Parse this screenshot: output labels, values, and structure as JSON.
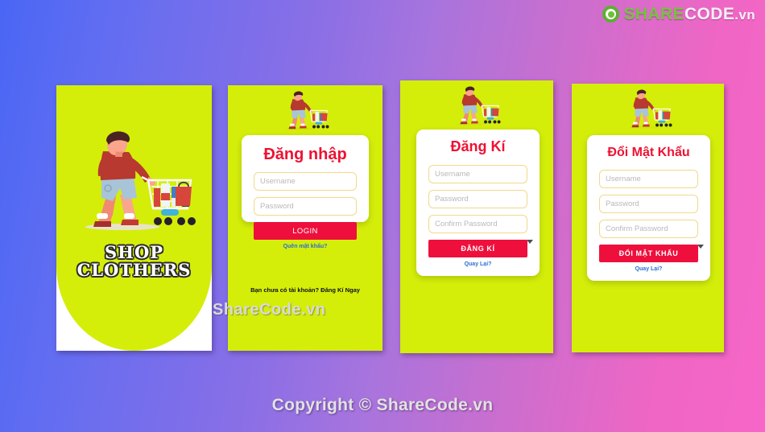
{
  "brand": {
    "logo_icon": "sharecode-recycle-icon",
    "logo_share": "SHARE",
    "logo_code": "CODE",
    "logo_vn": ".vn",
    "accent_red": "#ee0f3c",
    "accent_green": "#d4ee0a",
    "accent_blue_link": "#2b6fd4"
  },
  "watermarks": {
    "middle": "ShareCode.vn",
    "bottom": "Copyright © ShareCode.vn"
  },
  "panels": [
    {
      "name": "splash",
      "title_line1": "SHOP",
      "title_line2": "CLOTHERS",
      "illustration": "man-with-shopping-cart-illustration"
    },
    {
      "name": "login",
      "illustration": "man-with-shopping-cart-illustration",
      "card_title": "Đăng nhập",
      "fields": [
        {
          "name": "username",
          "placeholder": "Username",
          "value": ""
        },
        {
          "name": "password",
          "placeholder": "Password",
          "value": ""
        }
      ],
      "submit_label": "LOGIN",
      "sub_link": "Quên mật khẩu?",
      "footnote": "Bạn chưa có tài khoản?  Đăng Kí Ngay"
    },
    {
      "name": "register",
      "illustration": "man-with-shopping-cart-illustration",
      "card_title": "Đăng Kí",
      "fields": [
        {
          "name": "username",
          "placeholder": "Username",
          "value": ""
        },
        {
          "name": "password",
          "placeholder": "Password",
          "value": ""
        },
        {
          "name": "confirm-password",
          "placeholder": "Confirm Password",
          "value": ""
        }
      ],
      "submit_label": "ĐĂNG KÍ",
      "sub_link": "Quay Lại?"
    },
    {
      "name": "change-password",
      "illustration": "man-with-shopping-cart-illustration",
      "card_title": "Đổi Mật Khẩu",
      "fields": [
        {
          "name": "username",
          "placeholder": "Username",
          "value": ""
        },
        {
          "name": "password",
          "placeholder": "Password",
          "value": ""
        },
        {
          "name": "confirm-password",
          "placeholder": "Confirm Password",
          "value": ""
        }
      ],
      "submit_label": "ĐỔI MẬT KHẨU",
      "sub_link": "Quay Lại?"
    }
  ]
}
